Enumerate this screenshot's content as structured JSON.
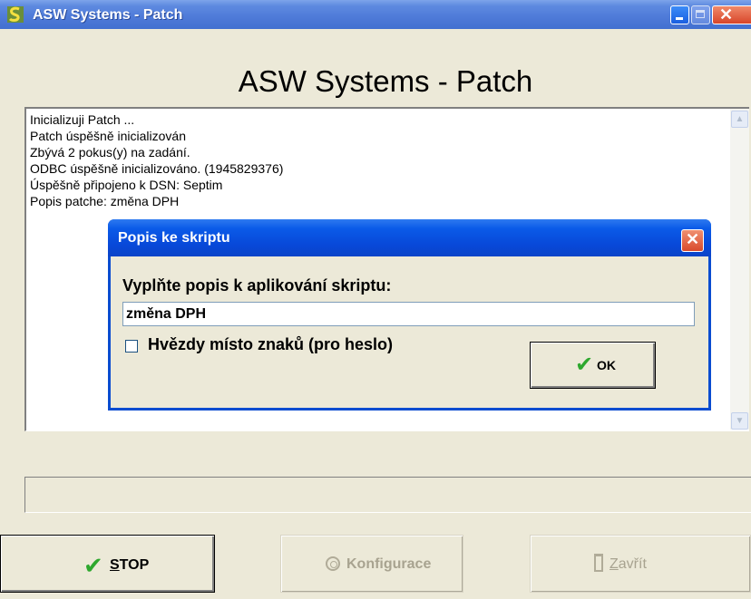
{
  "window": {
    "title": "ASW Systems  -  Patch"
  },
  "heading": "ASW Systems  -  Patch",
  "log": {
    "lines": [
      "Inicializuji Patch ...",
      "Patch úspěšně inicializován",
      "Zbývá 2 pokus(y) na zadání.",
      "ODBC úspěšně inicializováno. (1945829376)",
      "Úspěšně připojeno k DSN: Septim",
      "Popis patche: změna DPH"
    ]
  },
  "dialog": {
    "title": "Popis ke skriptu",
    "prompt": "Vyplňte popis k aplikování skriptu:",
    "input_value": "změna DPH",
    "checkbox_label": "Hvězdy místo znaků (pro heslo)",
    "checkbox_checked": false,
    "ok_label": "OK"
  },
  "buttons": {
    "stop_first": "S",
    "stop_rest": "TOP",
    "config": "Konfigurace",
    "close_first": "Z",
    "close_rest": "avřít"
  },
  "colors": {
    "titlebar": "#4e7ad8",
    "dialog_frame": "#0a4cd0",
    "ok_check": "#2ea82e"
  },
  "icons": [
    "app-icon",
    "minimize-icon",
    "maximize-icon",
    "close-icon",
    "check-icon",
    "config-icon",
    "door-icon"
  ]
}
